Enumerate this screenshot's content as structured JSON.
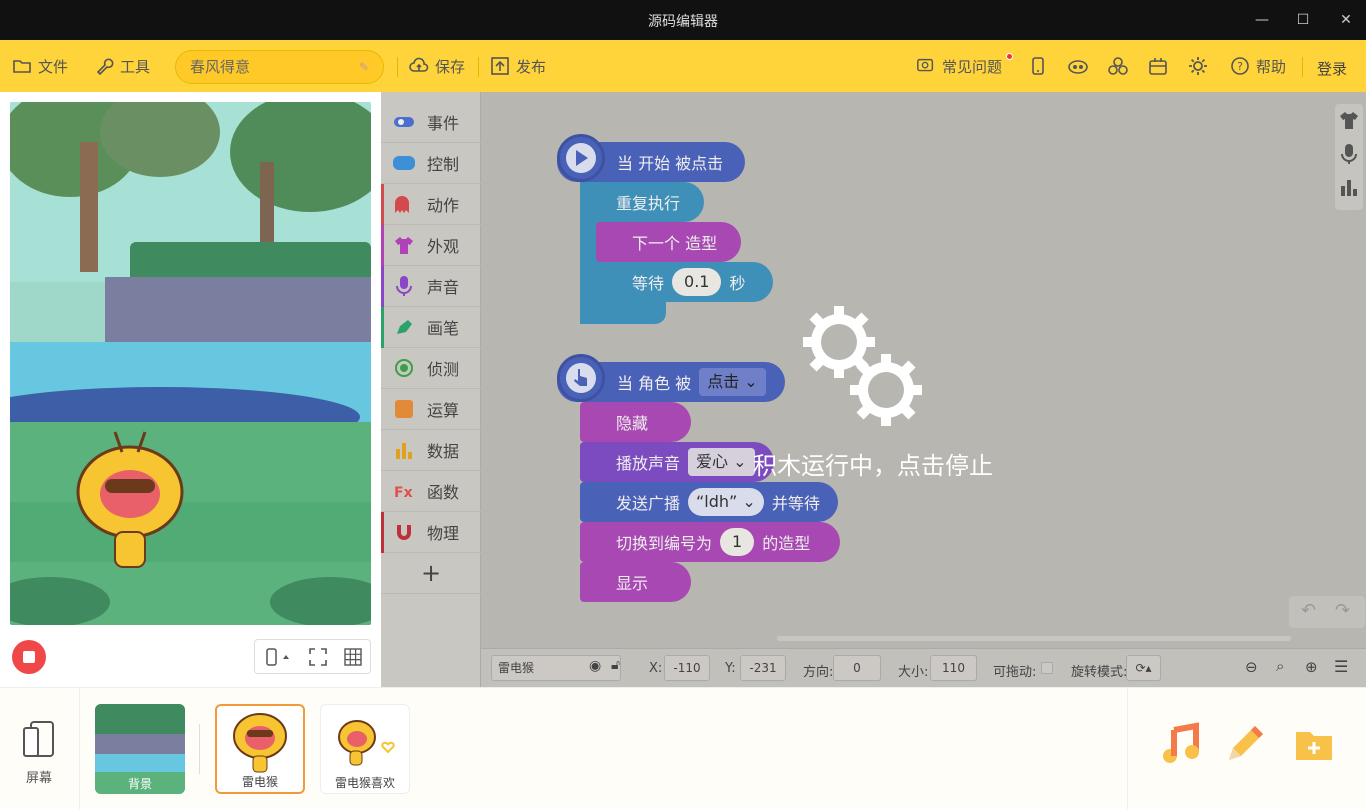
{
  "window": {
    "title": "源码编辑器",
    "minimize": "—",
    "maximize": "☐",
    "close": "✕"
  },
  "toolbar": {
    "file": "文件",
    "tools": "工具",
    "project_name": "春风得意",
    "save": "保存",
    "publish": "发布",
    "faq": "常见问题",
    "help": "帮助",
    "login": "登录"
  },
  "categories": [
    {
      "label": "事件",
      "color": "#4a6fd1"
    },
    {
      "label": "控制",
      "color": "#3d8fd6"
    },
    {
      "label": "动作",
      "color": "#d3494e"
    },
    {
      "label": "外观",
      "color": "#b041b7"
    },
    {
      "label": "声音",
      "color": "#8a45c8"
    },
    {
      "label": "画笔",
      "color": "#2aa36b"
    },
    {
      "label": "侦测",
      "color": "#3aa043"
    },
    {
      "label": "运算",
      "color": "#e08a3a"
    },
    {
      "label": "数据",
      "color": "#e0a020"
    },
    {
      "label": "函数",
      "color": "#e05050"
    },
    {
      "label": "物理",
      "color": "#c0303a"
    }
  ],
  "add_category": "+",
  "script1": {
    "hat": "当 开始 被点击",
    "repeat": "重复执行",
    "next_costume": "下一个 造型",
    "wait": "等待",
    "wait_value": "0.1",
    "wait_unit": "秒"
  },
  "script2": {
    "hat_prefix": "当 角色 被",
    "hat_dropdown": "点击",
    "hide": "隐藏",
    "play_sound": "播放声音",
    "sound_name": "爱心",
    "broadcast": "发送广播",
    "broadcast_msg": "“ldh”",
    "broadcast_suffix": "并等待",
    "switch_costume": "切换到编号为",
    "costume_num": "1",
    "costume_suffix": "的造型",
    "show": "显示"
  },
  "overlay_message": "积木运行中，点击停止",
  "props": {
    "sprite_name": "雷电猴",
    "x_label": "X:",
    "x": "-110",
    "y_label": "Y:",
    "y": "-231",
    "dir_label": "方向:",
    "dir": "0",
    "size_label": "大小:",
    "size": "110",
    "drag_label": "可拖动:",
    "rot_label": "旋转模式:"
  },
  "sprites": {
    "screen_label": "屏幕",
    "items": [
      {
        "name": "背景"
      },
      {
        "name": "雷电猴"
      },
      {
        "name": "雷电猴喜欢"
      }
    ]
  }
}
